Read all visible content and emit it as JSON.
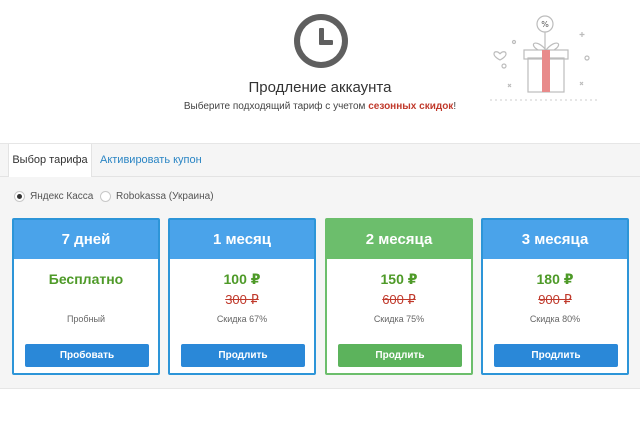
{
  "header": {
    "title": "Продление аккаунта",
    "subtitle_prefix": "Выберите подходящий тариф с учетом ",
    "subtitle_accent": "сезонных скидок",
    "subtitle_suffix": "!",
    "accent_color": "#c0392b",
    "clock_icon": "clock-icon",
    "gift_icon": "gift-icon",
    "gift_badge": "%"
  },
  "tabs": [
    {
      "label": "Выбор тарифа",
      "active": true
    },
    {
      "label": "Активировать купон",
      "active": false
    }
  ],
  "payment_methods": [
    {
      "label": "Яндекс Касса",
      "checked": true
    },
    {
      "label": "Robokassa (Украина)",
      "checked": false
    }
  ],
  "plans": [
    {
      "name": "7 дней",
      "price": "Бесплатно",
      "old_price": "",
      "note": "Пробный",
      "button": "Пробовать",
      "highlight": false
    },
    {
      "name": "1 месяц",
      "price": "100 ₽",
      "old_price": "300 ₽",
      "note": "Скидка 67%",
      "button": "Продлить",
      "highlight": false
    },
    {
      "name": "2 месяца",
      "price": "150 ₽",
      "old_price": "600 ₽",
      "note": "Скидка 75%",
      "button": "Продлить",
      "highlight": true
    },
    {
      "name": "3 месяца",
      "price": "180 ₽",
      "old_price": "900 ₽",
      "note": "Скидка 80%",
      "button": "Продлить",
      "highlight": false
    }
  ],
  "colors": {
    "blue": "#4aa3ea",
    "green": "#6cbe6c",
    "price_green": "#4e9a28",
    "old_price_red": "#c0392b",
    "link_blue": "#2a85c4"
  }
}
